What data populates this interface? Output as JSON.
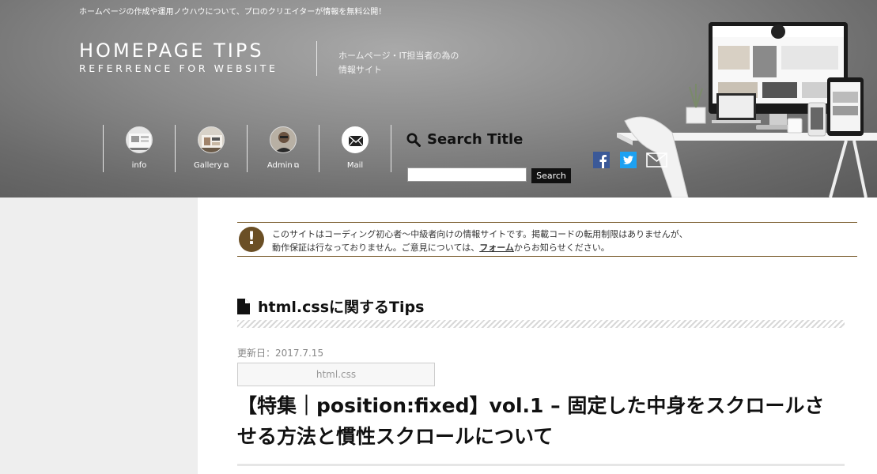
{
  "header": {
    "tagline": "ホームページの作成や運用ノウハウについて、プロのクリエイターが情報を無料公開！",
    "logo_title": "HOMEPAGE TIPS",
    "logo_subtitle": "REFERRENCE FOR WEBSITE",
    "description_line1": "ホームページ・IT担当者の為の",
    "description_line2": "情報サイト"
  },
  "nav": {
    "items": [
      {
        "label": "info",
        "icon": "info-photo-icon",
        "external": false
      },
      {
        "label": "Gallery",
        "icon": "gallery-photo-icon",
        "external": true
      },
      {
        "label": "Admin",
        "icon": "admin-avatar-icon",
        "external": true
      },
      {
        "label": "Mail",
        "icon": "mail-icon",
        "external": false
      }
    ],
    "external_icon": "external-link-icon"
  },
  "search": {
    "title": "Search Title",
    "placeholder": "",
    "button_label": "Search"
  },
  "social": {
    "icons": [
      "facebook-icon",
      "twitter-icon",
      "mail-icon"
    ]
  },
  "notice": {
    "icon_glyph": "!",
    "line1": "このサイトはコーディング初心者〜中級者向けの情報サイトです。掲載コードの転用制限はありませんが、",
    "line2_before": "動作保証は行なっておりません。ご意見については、",
    "link_text": "フォーム",
    "line2_after": "からお知らせください。"
  },
  "main": {
    "section_title": "html.cssに関するTips",
    "updated": "更新日：2017.7.15",
    "tag": "html.css",
    "article_title": "【特集｜position:fixed】vol.1 – 固定した中身をスクロールさせる方法と慣性スクロールについて"
  },
  "colors": {
    "notice_accent": "#6b4f25",
    "facebook": "#3b5998",
    "twitter": "#1da1f2",
    "sidebar_bg": "#eeeeee"
  }
}
